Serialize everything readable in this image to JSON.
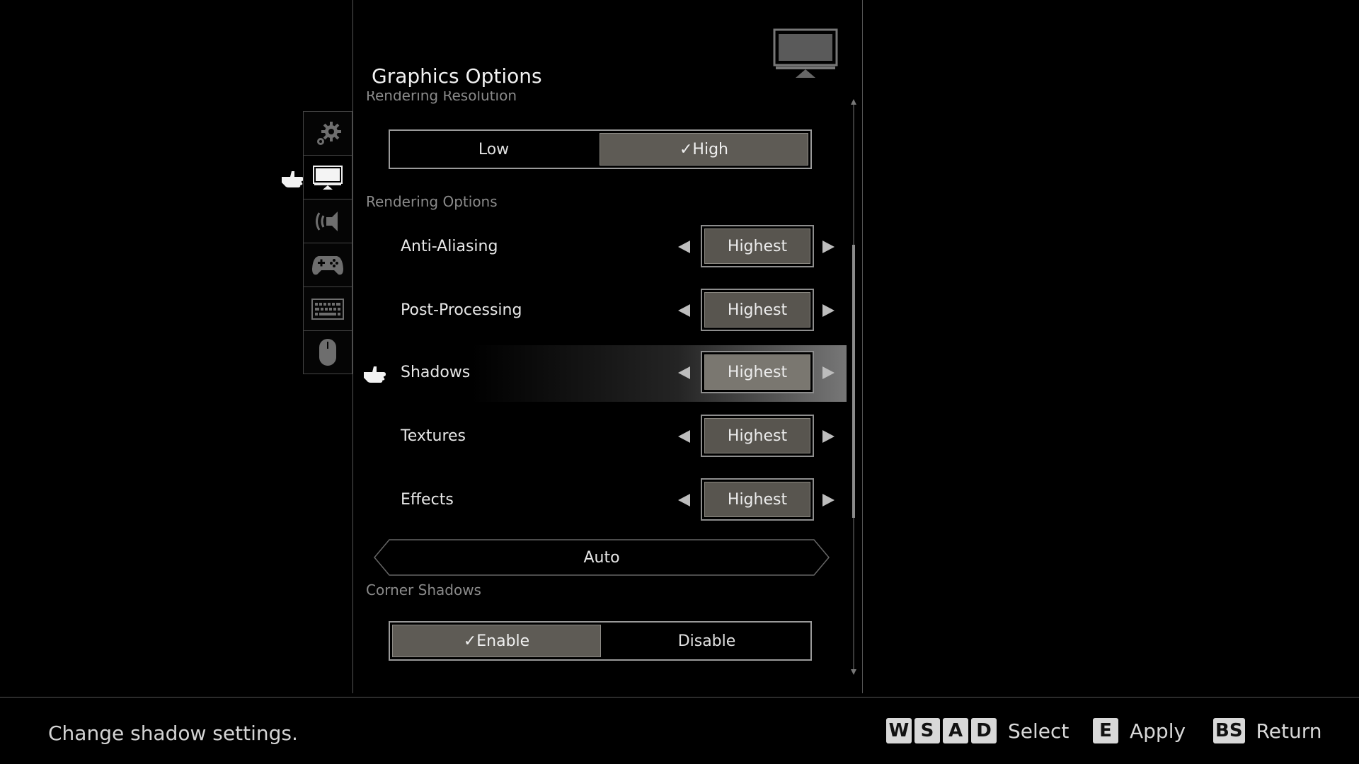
{
  "header": {
    "title": "Graphics Options"
  },
  "sections": {
    "rendering_resolution": {
      "label": "Rendering Resolution",
      "options": [
        "Low",
        "High"
      ],
      "selected_index": 1,
      "check_mark": "✓"
    },
    "rendering_options": {
      "label": "Rendering Options",
      "rows": [
        {
          "name": "Anti-Aliasing",
          "value": "Highest"
        },
        {
          "name": "Post-Processing",
          "value": "Highest"
        },
        {
          "name": "Shadows",
          "value": "Highest"
        },
        {
          "name": "Textures",
          "value": "Highest"
        },
        {
          "name": "Effects",
          "value": "Highest"
        }
      ],
      "selected_row": "Shadows",
      "auto_label": "Auto"
    },
    "corner_shadows": {
      "label": "Corner Shadows",
      "options": [
        "Enable",
        "Disable"
      ],
      "selected_index": 0,
      "check_mark": "✓"
    }
  },
  "sidebar": {
    "items": [
      "gear-icon",
      "monitor-icon",
      "speaker-icon",
      "gamepad-icon",
      "keyboard-icon",
      "mouse-icon"
    ],
    "active": "monitor-icon"
  },
  "footer": {
    "hint": "Change shadow settings.",
    "select_keys": [
      "W",
      "S",
      "A",
      "D"
    ],
    "select_label": "Select",
    "apply_key": "E",
    "apply_label": "Apply",
    "return_key": "BS",
    "return_label": "Return"
  },
  "colors": {
    "background": "#000000",
    "selected_fill": "#5e5b55",
    "text": "#e6e6e6",
    "muted": "#8a8a8a"
  }
}
